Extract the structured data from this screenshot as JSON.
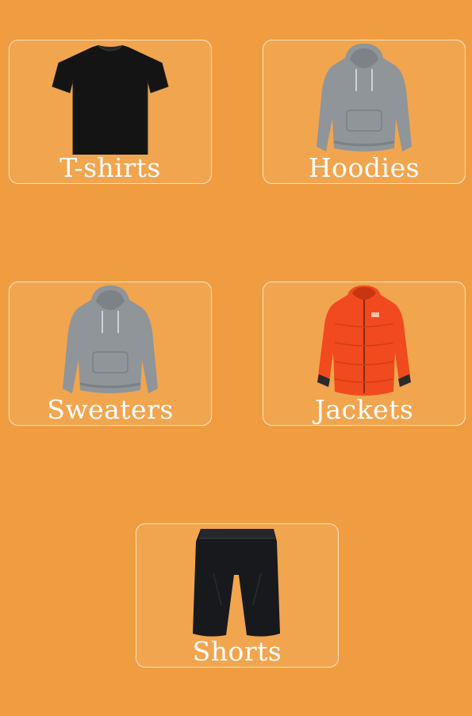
{
  "categories": [
    {
      "label": "T-shirts",
      "icon": "tshirt-icon",
      "color": "#151515"
    },
    {
      "label": "Hoodies",
      "icon": "hoodie-icon",
      "color": "#8f9598"
    },
    {
      "label": "Sweaters",
      "icon": "sweater-icon",
      "color": "#8f9598"
    },
    {
      "label": "Jackets",
      "icon": "jacket-icon",
      "color": "#f04a1e"
    },
    {
      "label": "Shorts",
      "icon": "shorts-icon",
      "color": "#17191c"
    }
  ],
  "colors": {
    "background": "#f09d42",
    "card": "#f1a54f",
    "card_border": "#fbe3c4",
    "label": "#ffffff"
  }
}
